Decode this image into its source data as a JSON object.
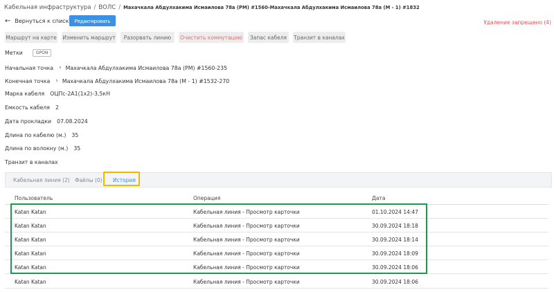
{
  "breadcrumb": {
    "root": "Кабельная инфраструктура",
    "sep": "/",
    "section": "ВОЛС",
    "sep2": "/",
    "current": "Махачкала Абдулхакима Исмаилова 78а (РМ) #1560-Махачкала Абдулхакима Исмаилова 78а (М - 1) #1832"
  },
  "header": {
    "back_label": "Вернуться к списку",
    "edit_label": "Редактировать",
    "delete_forbidden": "Удаление запрещено (4)"
  },
  "toolbar": {
    "buttons": [
      "Маршрут на карте",
      "Изменить маршрут",
      "Разорвать линию",
      "Очистить коммутацию",
      "Запас кабеля",
      "Транзит в каналах"
    ]
  },
  "fields": {
    "tags_label": "Метки",
    "tag": "GPON",
    "start_label": "Начальная точка",
    "start_value": "Махачкала Абдулхакима Исмаилова 78а (РМ) #1560-235",
    "end_label": "Конечная точка",
    "end_value": "Махачкала Абдулхакима Исмаилова 78а (М - 1) #1532-270",
    "brand_label": "Марка кабеля",
    "brand_value": "ОЦПс-2А1(1х2)-3,5кН",
    "capacity_label": "Емкость кабеля",
    "capacity_value": "2",
    "date_label": "Дата прокладки",
    "date_value": "07.08.2024",
    "len_cable_label": "Длина по кабелю (м.)",
    "len_cable_value": "35",
    "len_fiber_label": "Длина по волокну (м.)",
    "len_fiber_value": "35",
    "transit_label": "Транзит в каналах"
  },
  "tabs": [
    {
      "label": "Кабельная линия (2)"
    },
    {
      "label": "Файлы (0)"
    },
    {
      "label": "История"
    }
  ],
  "table": {
    "headers": [
      "Пользователь",
      "Операция",
      "Дата"
    ],
    "rows": [
      [
        "Katan Katan",
        "Кабельная линия - Просмотр карточки",
        "01.10.2024 14:47"
      ],
      [
        "Katan Katan",
        "Кабельная линия - Просмотр карточки",
        "30.09.2024 18:18"
      ],
      [
        "Katan Katan",
        "Кабельная линия - Просмотр карточки",
        "30.09.2024 18:14"
      ],
      [
        "Katan Katan",
        "Кабельная линия - Просмотр карточки",
        "30.09.2024 18:09"
      ],
      [
        "Katan Katan",
        "Кабельная линия - Просмотр карточки",
        "30.09.2024 18:06"
      ],
      [
        "Katan Katan",
        "Кабельная линия - Просмотр карточки",
        "30.09.2024 18:06"
      ]
    ]
  },
  "colors": {
    "accent": "#3b91e4",
    "danger": "#e05151",
    "highlight_yellow": "#f2b600",
    "highlight_green": "#0ea04b"
  }
}
